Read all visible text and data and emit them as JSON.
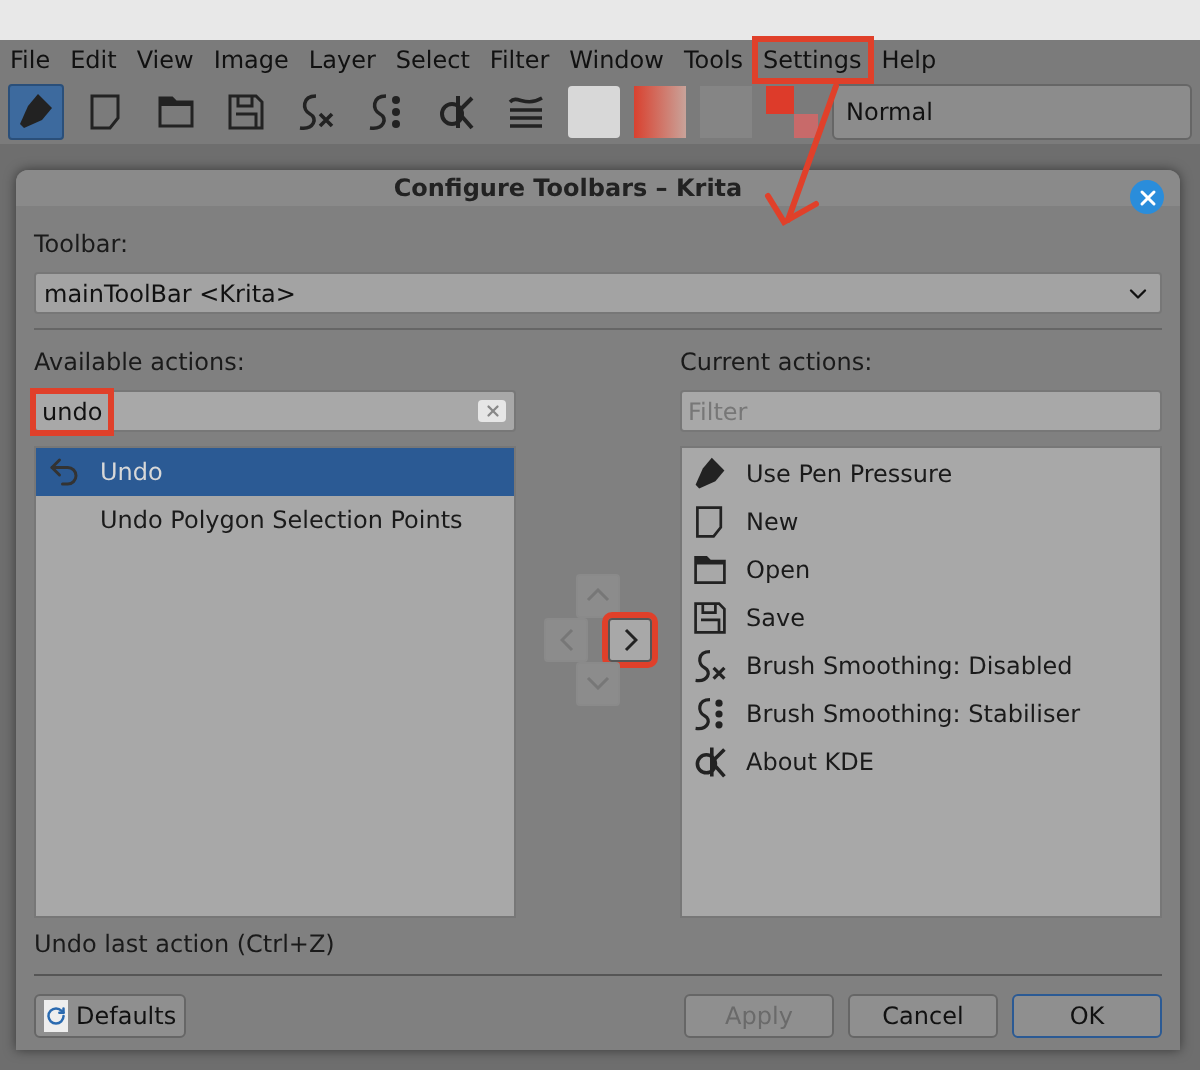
{
  "menu": [
    {
      "label": "File",
      "annotated": false
    },
    {
      "label": "Edit",
      "annotated": false
    },
    {
      "label": "View",
      "annotated": false
    },
    {
      "label": "Image",
      "annotated": false
    },
    {
      "label": "Layer",
      "annotated": false
    },
    {
      "label": "Select",
      "annotated": false
    },
    {
      "label": "Filter",
      "annotated": false
    },
    {
      "label": "Window",
      "annotated": false
    },
    {
      "label": "Tools",
      "annotated": false
    },
    {
      "label": "Settings",
      "annotated": true
    },
    {
      "label": "Help",
      "annotated": false
    }
  ],
  "toolbar": {
    "tools": [
      {
        "kind": "pen",
        "selected": true
      },
      {
        "kind": "new",
        "selected": false
      },
      {
        "kind": "open",
        "selected": false
      },
      {
        "kind": "save",
        "selected": false
      },
      {
        "kind": "smooth-off",
        "selected": false
      },
      {
        "kind": "smooth-stab",
        "selected": false
      },
      {
        "kind": "kde",
        "selected": false
      },
      {
        "kind": "lines",
        "selected": false
      }
    ],
    "blend_mode": "Normal"
  },
  "dialog": {
    "title": "Configure Toolbars – Krita",
    "toolbar_label": "Toolbar:",
    "toolbar_value": "mainToolBar <Krita>",
    "available": {
      "label": "Available actions:",
      "search": {
        "value": "undo",
        "annotated": true
      },
      "items": [
        {
          "label": "Undo",
          "kind": "undo",
          "selected": true
        },
        {
          "label": "Undo Polygon Selection Points",
          "kind": "plain",
          "selected": false
        }
      ]
    },
    "move_buttons": [
      {
        "kind": "up",
        "disabled": true,
        "annotated": false
      },
      {
        "kind": "left",
        "disabled": true,
        "annotated": false
      },
      {
        "kind": "right",
        "disabled": false,
        "annotated": true
      },
      {
        "kind": "down",
        "disabled": true,
        "annotated": false
      }
    ],
    "current": {
      "label": "Current actions:",
      "filter": {
        "placeholder": "Filter"
      },
      "items": [
        {
          "label": "Use Pen Pressure",
          "kind": "pen",
          "selected": false
        },
        {
          "label": "New",
          "kind": "new",
          "selected": false
        },
        {
          "label": "Open",
          "kind": "open",
          "selected": false
        },
        {
          "label": "Save",
          "kind": "save",
          "selected": false
        },
        {
          "label": "Brush Smoothing: Disabled",
          "kind": "smooth-off",
          "selected": false
        },
        {
          "label": "Brush Smoothing: Stabiliser",
          "kind": "smooth-stab",
          "selected": false
        },
        {
          "label": "About KDE",
          "kind": "kde",
          "selected": false
        }
      ]
    },
    "description": "Undo last action (Ctrl+Z)",
    "buttons": [
      {
        "label": "Defaults",
        "kind": "defaults",
        "disabled": false
      },
      {
        "label": "Apply",
        "kind": "normal",
        "disabled": true
      },
      {
        "label": "Cancel",
        "kind": "normal",
        "disabled": false
      },
      {
        "label": "OK",
        "kind": "default",
        "disabled": false
      }
    ]
  }
}
